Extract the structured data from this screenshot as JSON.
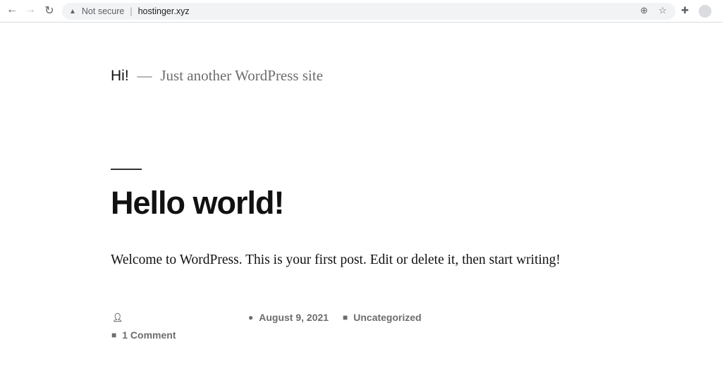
{
  "browser": {
    "security": "Not secure",
    "url": "hostinger.xyz"
  },
  "site": {
    "title": "Hi!",
    "dash": "—",
    "tagline": "Just another WordPress site"
  },
  "post": {
    "title": "Hello world!",
    "body": "Welcome to WordPress. This is your first post. Edit or delete it, then start writing!",
    "date": "August 9, 2021",
    "category": "Uncategorized",
    "comments": "1 Comment"
  }
}
